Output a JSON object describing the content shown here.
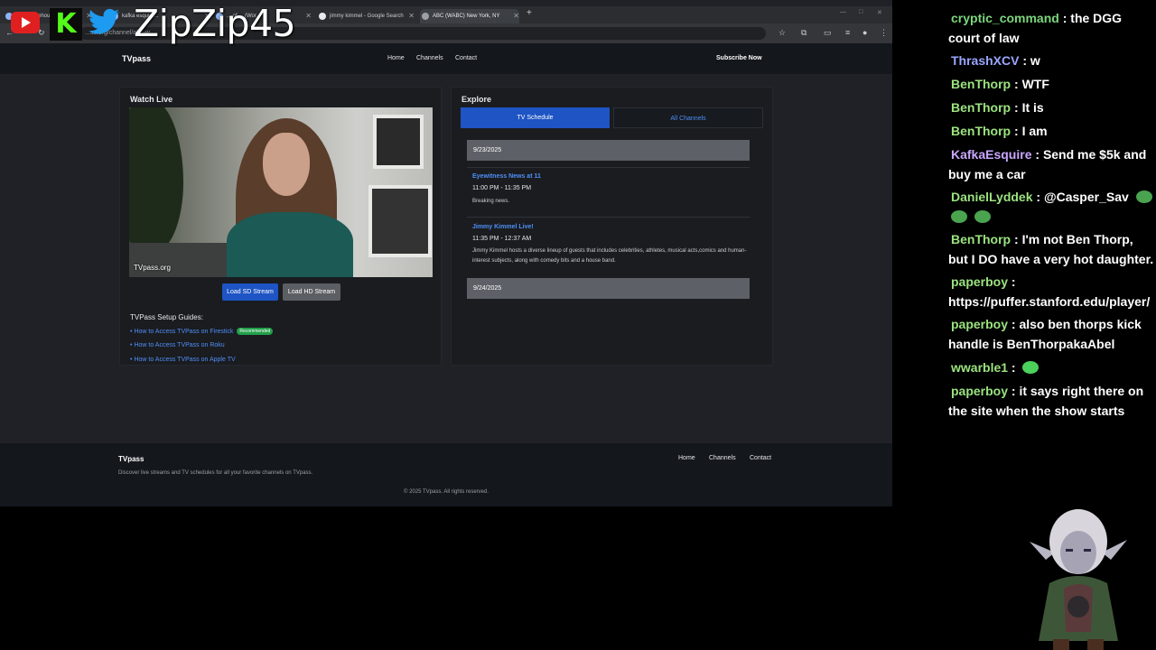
{
  "overlay": {
    "handle": "ZipZip45"
  },
  "browser": {
    "tabs": [
      {
        "label": "The Whitehou..."
      },
      {
        "label": "kafka esquire..."
      },
      {
        "label": "... of ... (Wor..."
      },
      {
        "label": "jimmy kimmel - Google Search"
      },
      {
        "label": "ABC (WABC) New York, NY"
      }
    ],
    "new_tab": "+",
    "url": "...ss.org/channel/abc-w..."
  },
  "site": {
    "brand": "TVpass",
    "nav": [
      "Home",
      "Channels",
      "Contact"
    ],
    "subscribe": "Subscribe Now",
    "watch": {
      "title": "Watch Live",
      "video_label": "TVpass.org",
      "sd_button": "Load SD Stream",
      "hd_button": "Load HD Stream",
      "guides_title": "TVPass Setup Guides:",
      "guides": [
        "How to Access TVPass on Firestick",
        "How to Access TVPass on Roku",
        "How to Access TVPass on Apple TV"
      ],
      "recommended": "Recommended"
    },
    "explore": {
      "title": "Explore",
      "tab_schedule": "TV Schedule",
      "tab_channels": "All Channels",
      "day1": "9/23/2025",
      "day2": "9/24/2025",
      "shows": [
        {
          "title": "Eyewitness News at 11",
          "time": "11:00 PM - 11:35 PM",
          "desc": "Breaking news."
        },
        {
          "title": "Jimmy Kimmel Live!",
          "time": "11:35 PM - 12:37 AM",
          "desc": "Jimmy Kimmel hosts a diverse lineup of guests that includes celebrities, athletes, musical acts,comics and human-interest subjects, along with comedy bits and a house band."
        }
      ]
    },
    "footer": {
      "brand": "TVpass",
      "tagline": "Discover live streams and TV schedules for all your favorite channels on TVpass.",
      "links": [
        "Home",
        "Channels",
        "Contact"
      ],
      "copyright": "© 2025 TVpass. All rights reserved."
    }
  },
  "chat": [
    {
      "user": "cryptic_command",
      "color": "#7cd67c",
      "text": "the DGG court of law"
    },
    {
      "user": "ThrashXCV",
      "color": "#9aa6ff",
      "text": "w"
    },
    {
      "user": "BenThorp",
      "color": "#9be37f",
      "text": "WTF"
    },
    {
      "user": "BenThorp",
      "color": "#9be37f",
      "text": "It is"
    },
    {
      "user": "BenThorp",
      "color": "#9be37f",
      "text": "I am"
    },
    {
      "user": "KafkaEsquire",
      "color": "#c9a6ff",
      "text": "Send me $5k and buy me a car"
    },
    {
      "user": "DanielLyddek",
      "color": "#9be37f",
      "text": "@Casper_Sav"
    },
    {
      "user": "BenThorp",
      "color": "#9be37f",
      "text": "I'm not Ben Thorp, but I DO have a very hot daughter."
    },
    {
      "user": "paperboy",
      "color": "#9be37f",
      "text": "https://puffer.stanford.edu/player/"
    },
    {
      "user": "paperboy",
      "color": "#9be37f",
      "text": "also ben thorps kick handle is BenThorpakaAbel"
    },
    {
      "user": "wwarble1",
      "color": "#9be37f",
      "text": ""
    },
    {
      "user": "paperboy",
      "color": "#9be37f",
      "text": "it says right there on the site when the show starts"
    }
  ]
}
